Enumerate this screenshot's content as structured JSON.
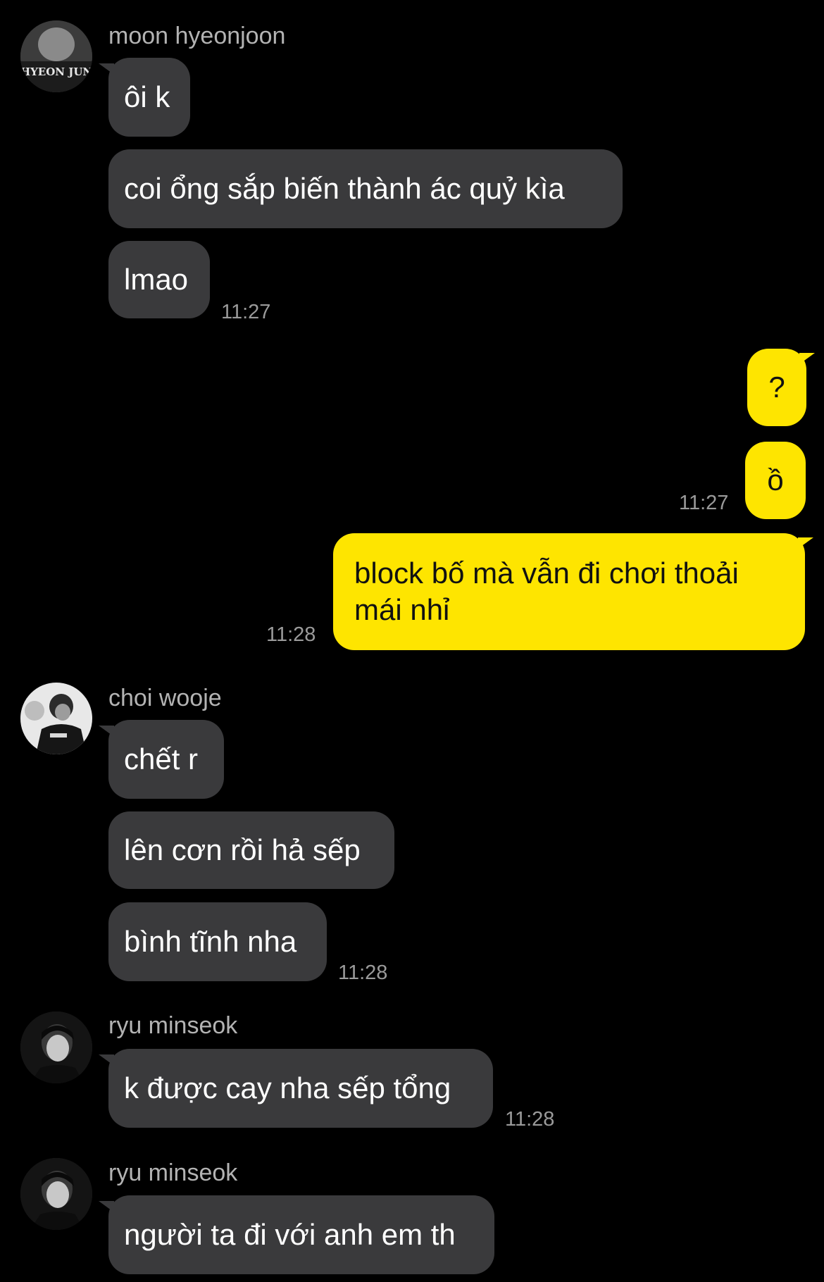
{
  "colors": {
    "background": "#000000",
    "incoming_bubble": "#3a3a3c",
    "outgoing_bubble": "#fee500",
    "timestamp": "#9a9a9a",
    "sender_name": "#b3b3b3"
  },
  "groups": [
    {
      "sender": "moon hyeonjoon",
      "avatar_label": "HYEON JUN",
      "messages": [
        "ôi k",
        "coi ổng sắp biến thành ác quỷ kìa",
        "lmao"
      ],
      "time": "11:27"
    },
    {
      "sender": "me",
      "messages": [
        "?",
        "ồ"
      ],
      "time": "11:27"
    },
    {
      "sender": "me",
      "messages": [
        "block bố mà vẫn đi chơi thoải mái nhỉ"
      ],
      "time": "11:28"
    },
    {
      "sender": "choi wooje",
      "messages": [
        "chết r",
        "lên cơn rồi hả sếp",
        "bình tĩnh nha"
      ],
      "time": "11:28"
    },
    {
      "sender": "ryu minseok",
      "messages": [
        "k được cay nha sếp tổng"
      ],
      "time": "11:28"
    },
    {
      "sender": "ryu minseok",
      "messages": [
        "người ta đi với anh em th"
      ]
    }
  ]
}
